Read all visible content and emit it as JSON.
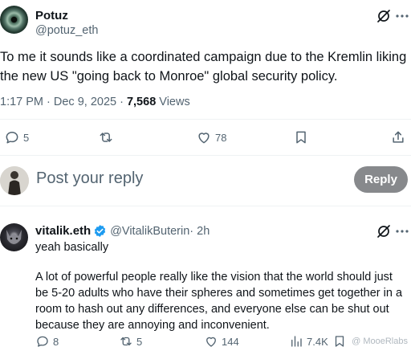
{
  "tweet": {
    "author_name": "Potuz",
    "author_handle": "@potuz_eth",
    "text": "To me it sounds like a coordinated campaign due to the Kremlin liking the new US \"going back to Monroe\" global security policy.",
    "time": "1:17 PM · Dec 9, 2025 · ",
    "views_count": "7,568",
    "views_label": "Views",
    "actions": {
      "replies": "5",
      "reposts": "",
      "likes": "78"
    }
  },
  "reply_box": {
    "placeholder": "Post your reply",
    "button_label": "Reply"
  },
  "reply": {
    "author_name": "vitalik.eth",
    "author_handle": "@VitalikButerin",
    "time": " · 2h",
    "line1": "yeah basically",
    "paragraph": "A lot of powerful people really like the vision that the world should just be 5-20 adults who have their spheres and sometimes get together in a room to hash out any differences, and everyone else can be shut out because they are annoying and inconvenient.",
    "actions": {
      "replies": "8",
      "reposts": "5",
      "likes": "144",
      "views": "7.4K"
    }
  },
  "watermark": "@ MooeRlabs",
  "colors": {
    "text": "#0f1419",
    "secondary": "#536471",
    "verified": "#1d9bf0",
    "reply_button": "#87898c"
  }
}
